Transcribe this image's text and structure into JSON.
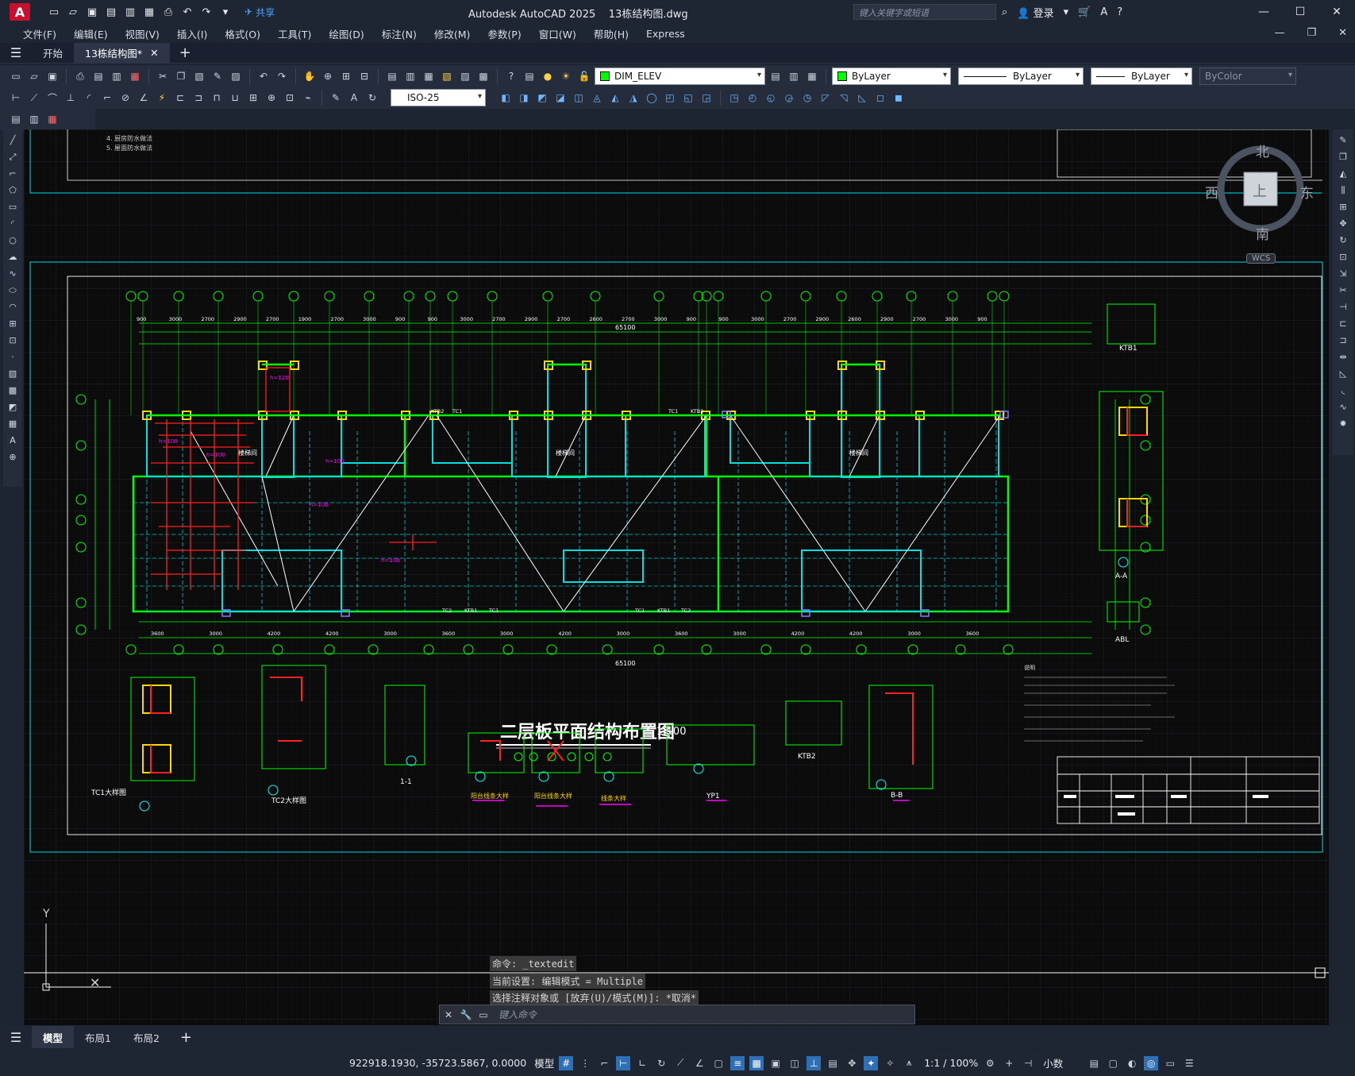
{
  "app": {
    "logo": "A",
    "title": "Autodesk AutoCAD 2025",
    "filename": "13栋结构图.dwg",
    "share": "共享",
    "search_placeholder": "键入关键字或短语",
    "login": "登录"
  },
  "menu": [
    "文件(F)",
    "编辑(E)",
    "视图(V)",
    "插入(I)",
    "格式(O)",
    "工具(T)",
    "绘图(D)",
    "标注(N)",
    "修改(M)",
    "参数(P)",
    "窗口(W)",
    "帮助(H)",
    "Express"
  ],
  "tabs": {
    "start": "开始",
    "doc": "13栋结构图*"
  },
  "toolbar": {
    "layer": "DIM_ELEV",
    "color": "ByLayer",
    "linetype": "ByLayer",
    "lineweight": "ByLayer",
    "plotstyle": "ByColor",
    "dimstyle": "ISO-25"
  },
  "colors": {
    "layer_swatch": "#00ff00",
    "accent": "#2f6fb3",
    "brand": "#c8102e"
  },
  "viewcube": {
    "north": "北",
    "south": "南",
    "east": "东",
    "west": "西",
    "top": "上",
    "wcs": "WCS"
  },
  "drawing": {
    "main_title": "二层板平面结构布置图",
    "scale": "1:100",
    "total_dim": "65100",
    "top_dims": [
      "900",
      "3000",
      "2700",
      "2900",
      "2700",
      "1900",
      "2700",
      "3000",
      "900",
      "900",
      "3000",
      "2700",
      "2900",
      "2700",
      "2600",
      "2700",
      "3000",
      "900",
      "900",
      "3000",
      "2700",
      "2900",
      "2600",
      "2900",
      "2700",
      "3000",
      "900"
    ],
    "bottom_dims": [
      "3600",
      "3000",
      "4200",
      "4200",
      "3000",
      "3600",
      "3000",
      "4200",
      "3000",
      "3600",
      "3000",
      "4200",
      "4200",
      "3000",
      "3600"
    ],
    "details": [
      "TC1大样图",
      "TC2大样图",
      "1-1",
      "阳台线条大样",
      "阳台线条大样",
      "线条大样",
      "YP1",
      "KTB2",
      "B-B",
      "KTB1",
      "A-A",
      "ABL"
    ],
    "notes_title": "说明",
    "stair": "楼梯间",
    "tc_labels": [
      "KTB2",
      "TC1",
      "TC1",
      "KTB2",
      "TC2",
      "KTB1",
      "TC1",
      "TC1",
      "KTB1",
      "TC2"
    ]
  },
  "command": {
    "line1": "命令: _textedit",
    "line2": "当前设置: 编辑模式 = Multiple",
    "line3": "选择注释对象或 [放弃(U)/模式(M)]: *取消*",
    "input_placeholder": "键入命令"
  },
  "layouts": [
    "模型",
    "布局1",
    "布局2"
  ],
  "status": {
    "coords": "922918.1930, -35723.5867, 0.0000",
    "model": "模型",
    "scale": "1:1 / 100%",
    "units": "小数"
  }
}
